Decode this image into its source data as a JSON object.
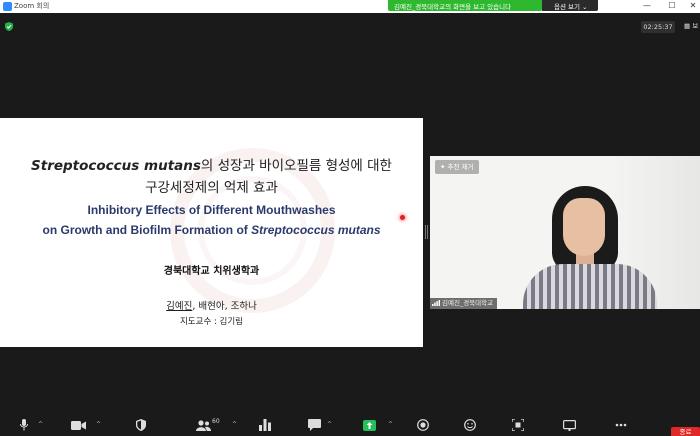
{
  "window": {
    "title": "Zoom 회의"
  },
  "share_banner": {
    "text": "김예진_경북대학교의 화면을 보고 있습니다",
    "view_options_label": "옵션 보기 ⌄"
  },
  "meeting": {
    "timer": "02:25:37",
    "view_label": "보"
  },
  "slide": {
    "title_ko_line1_italic": "Streptococcus mutans",
    "title_ko_line1_rest": "의 성장과 바이오필름 형성에 대한",
    "title_ko_line2": "구강세정제의 억제 효과",
    "title_en_line1": "Inhibitory Effects of Different Mouthwashes",
    "title_en_line2_plain": "on Growth and Biofilm Formation of ",
    "title_en_line2_italic": "Streptococcus mutans",
    "department": "경북대학교 치위생학과",
    "author_presenter": "김예진",
    "author_rest": ", 배현아, 조하나",
    "advisor": "지도교수 : 김기림"
  },
  "video": {
    "unpin_label": "추천 제거",
    "participant_name": "김예진_경북대학교"
  },
  "toolbar": {
    "participants_count": "60",
    "end_label": "종료"
  },
  "colors": {
    "share_banner": "#2eb82e",
    "end_button": "#e02828",
    "background": "#1a1a1a",
    "slide_title_en": "#2b3a6b"
  }
}
